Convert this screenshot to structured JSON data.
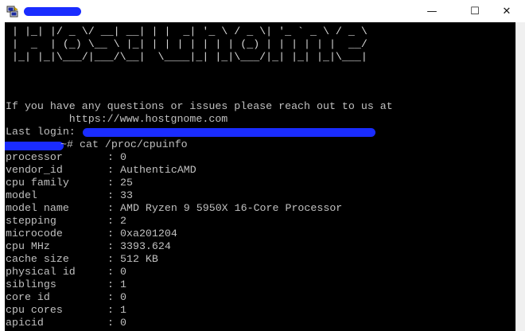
{
  "window": {
    "colors": {
      "redaction": "#1a2cff",
      "terminal_bg": "#000000",
      "terminal_fg": "#c0c0c0"
    },
    "controls": {
      "minimize": "—",
      "maximize": "☐",
      "close": "✕"
    }
  },
  "banner": {
    "ascii_lines": [
      " | |_| |/ _ \\/ __| __| | |  _| '_ \\ / _ \\| '_ ` _ \\ / _ \\",
      " |  _  | (_) \\__ \\ |_| | | | | | | | (_) | | | | | |  __/",
      " |_| |_|\\___/|___/\\__|  \\____|_| |_|\\___/|_| |_| |_|\\___|"
    ],
    "help_line": "If you have any questions or issues please reach out to us at",
    "help_url": "          https://www.hostgnome.com",
    "last_login_label": "Last login: "
  },
  "prompt": {
    "suffix": "~# ",
    "command": "cat /proc/cpuinfo"
  },
  "cpuinfo": [
    {
      "key": "processor",
      "value": "0"
    },
    {
      "key": "vendor_id",
      "value": "AuthenticAMD"
    },
    {
      "key": "cpu family",
      "value": "25"
    },
    {
      "key": "model",
      "value": "33"
    },
    {
      "key": "model name",
      "value": "AMD Ryzen 9 5950X 16-Core Processor"
    },
    {
      "key": "stepping",
      "value": "2"
    },
    {
      "key": "microcode",
      "value": "0xa201204"
    },
    {
      "key": "cpu MHz",
      "value": "3393.624"
    },
    {
      "key": "cache size",
      "value": "512 KB"
    },
    {
      "key": "physical id",
      "value": "0"
    },
    {
      "key": "siblings",
      "value": "1"
    },
    {
      "key": "core id",
      "value": "0"
    },
    {
      "key": "cpu cores",
      "value": "1"
    },
    {
      "key": "apicid",
      "value": "0"
    }
  ],
  "separator": ": "
}
